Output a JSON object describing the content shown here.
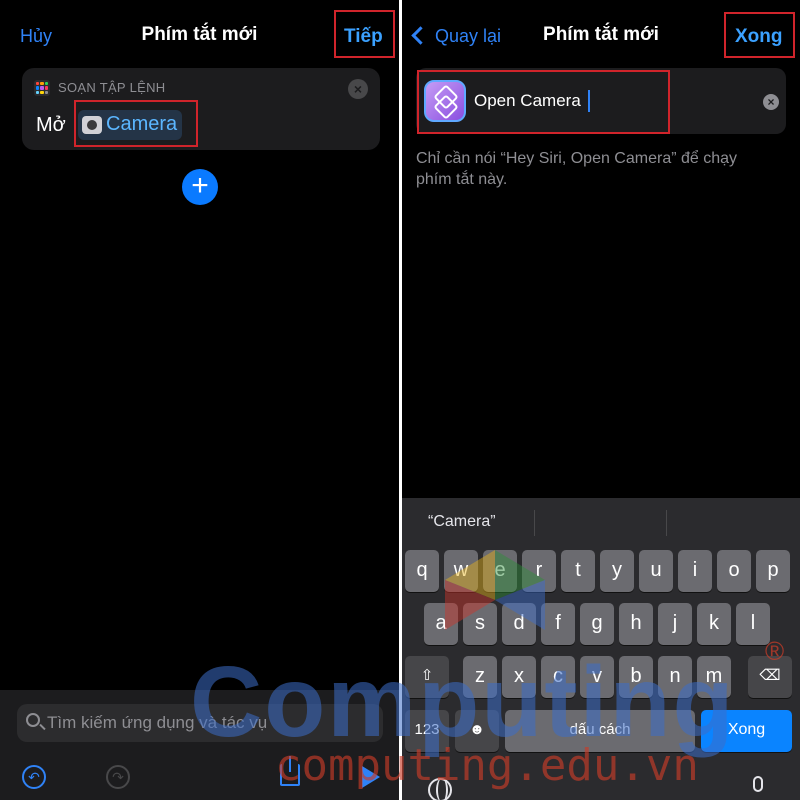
{
  "left": {
    "nav": {
      "cancel": "Hủy",
      "title": "Phím tắt mới",
      "next": "Tiếp"
    },
    "action_card": {
      "caption": "SOẠN TẬP LỆNH",
      "verb": "Mở",
      "app_token": "Camera",
      "app_icon": "camera-icon"
    },
    "search": {
      "placeholder": "Tìm kiếm ứng dụng và tác vụ"
    },
    "toolbar": {
      "undo_icon": "undo-icon",
      "redo_icon": "redo-icon",
      "share_icon": "share-icon",
      "play_icon": "play-icon"
    }
  },
  "right": {
    "nav": {
      "back": "Quay lại",
      "title": "Phím tắt mới",
      "done": "Xong"
    },
    "name_field": {
      "value": "Open Camera",
      "icon": "shortcuts-app-icon"
    },
    "hint": "Chỉ cần nói “Hey Siri, Open Camera” để chạy phím tắt này.",
    "keyboard": {
      "suggestion": "“Camera”",
      "row1": [
        "q",
        "w",
        "e",
        "r",
        "t",
        "y",
        "u",
        "i",
        "o",
        "p"
      ],
      "row2": [
        "a",
        "s",
        "d",
        "f",
        "g",
        "h",
        "j",
        "k",
        "l"
      ],
      "row3": [
        "z",
        "x",
        "c",
        "v",
        "b",
        "n",
        "m"
      ],
      "numbers_key": "123",
      "emoji_key": "☻",
      "space_key": "dấu cách",
      "return_key": "Xong"
    }
  },
  "watermark": {
    "brand": "Computing",
    "url": "computing.edu.vn",
    "mark": "®"
  },
  "colors": {
    "accent": "#2f82f6",
    "highlight": "#d0242b",
    "background": "#000000"
  }
}
